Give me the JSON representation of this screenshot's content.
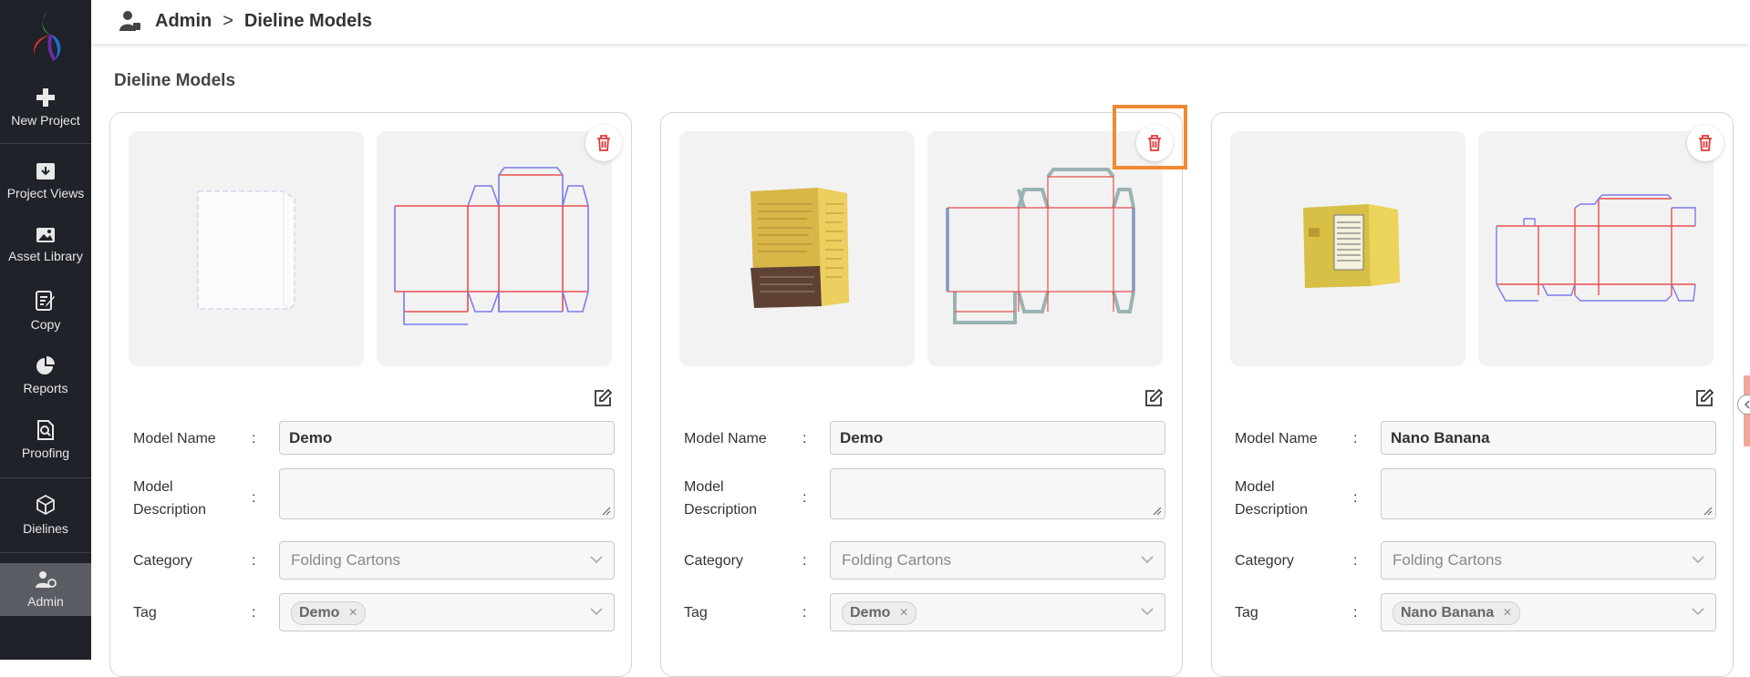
{
  "sidebar": {
    "items": [
      {
        "label": "New Project",
        "icon": "plus-icon"
      },
      {
        "label": "Project Views",
        "icon": "download-box-icon"
      },
      {
        "label": "Asset Library",
        "icon": "image-icon"
      },
      {
        "label": "Copy",
        "icon": "edit-document-icon"
      },
      {
        "label": "Reports",
        "icon": "pie-chart-icon"
      },
      {
        "label": "Proofing",
        "icon": "search-document-icon"
      },
      {
        "label": "Dielines",
        "icon": "cube-icon"
      },
      {
        "label": "Admin",
        "icon": "admin-user-icon"
      }
    ],
    "active": "Admin"
  },
  "header": {
    "breadcrumb": [
      "Admin",
      "Dieline Models"
    ],
    "separator": ">"
  },
  "page": {
    "title": "Dieline Models"
  },
  "labels": {
    "model_name": "Model Name",
    "model_description_line1": "Model",
    "model_description_line2": "Description",
    "category": "Category",
    "tag": "Tag",
    "colon": ":",
    "chip_remove": "×"
  },
  "cards": [
    {
      "model_name": "Demo",
      "model_description": "",
      "category": "Folding Cartons",
      "tag": "Demo"
    },
    {
      "model_name": "Demo",
      "model_description": "",
      "category": "Folding Cartons",
      "tag": "Demo"
    },
    {
      "model_name": "Nano Banana",
      "model_description": "",
      "category": "Folding Cartons",
      "tag": "Nano Banana"
    }
  ],
  "colors": {
    "sidebar_bg": "#1f2228",
    "delete_red": "#e03a3a",
    "highlight_orange": "#f08a32"
  }
}
